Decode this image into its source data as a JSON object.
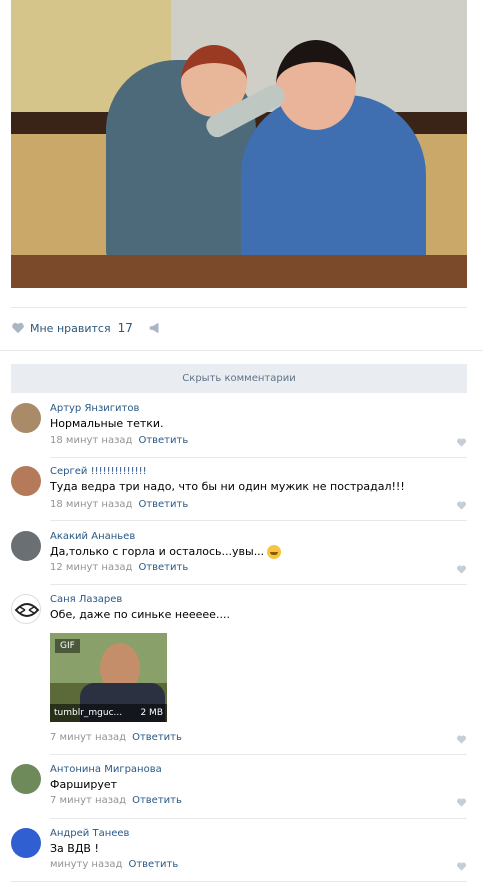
{
  "post": {
    "likes_label": "Мне нравится",
    "likes_count": "17"
  },
  "comments_toggle": "Скрыть комментарии",
  "comments": [
    {
      "author": "Артур Янзигитов",
      "text": "Нормальные тетки.",
      "time": "18 минут назад",
      "reply": "Ответить"
    },
    {
      "author": "Сергей !!!!!!!!!!!!!!",
      "text": "Туда ведра три надо, что бы ни один мужик не пострадал!!!",
      "time": "18 минут назад",
      "reply": "Ответить"
    },
    {
      "author": "Акакий Ананьев",
      "text": "Да,только с горла и осталось...увы...",
      "time": "12 минут назад",
      "reply": "Ответить"
    },
    {
      "author": "Саня Лазарев",
      "text": "Обе, даже по синьке неееее....",
      "time": "7 минут назад",
      "reply": "Ответить",
      "attachment": {
        "badge": "GIF",
        "name": "tumblr_mguc...",
        "size": "2 MB"
      }
    },
    {
      "author": "Антонина Мигранова",
      "text": "Фарширует",
      "time": "7 минут назад",
      "reply": "Ответить"
    },
    {
      "author": "Андрей Танеев",
      "text": "За ВДВ !",
      "time": "минуту назад",
      "reply": "Ответить"
    }
  ],
  "icons": {
    "like": "heart-icon",
    "share": "megaphone-icon"
  },
  "colors": {
    "link": "#2a5885",
    "meta": "#939393",
    "button_bg": "#e9ecf0"
  }
}
